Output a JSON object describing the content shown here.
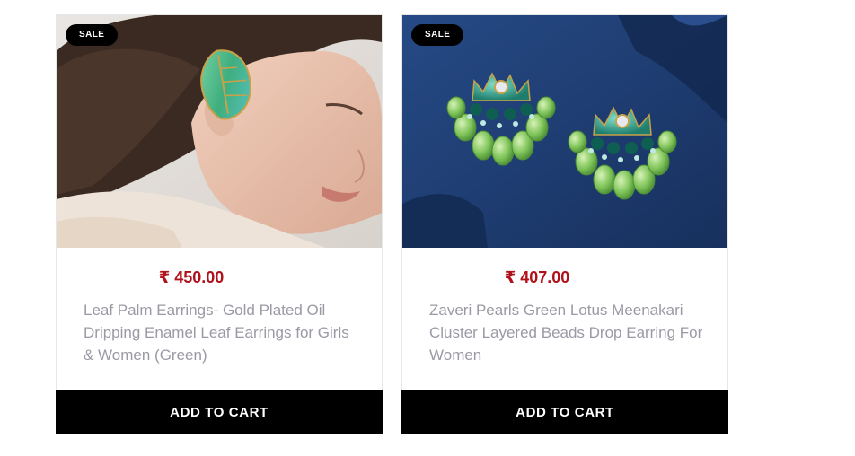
{
  "currency_symbol": "₹",
  "products": [
    {
      "badge": "SALE",
      "price": "₹ 450.00",
      "title": "Leaf Palm Earrings- Gold Plated Oil Dripping Enamel Leaf Earrings for Girls & Women (Green)",
      "cta": "ADD TO CART"
    },
    {
      "badge": "SALE",
      "price": "₹ 407.00",
      "title": "Zaveri Pearls Green Lotus Meenakari Cluster Layered Beads Drop Earring For Women",
      "cta": "ADD TO CART"
    }
  ],
  "colors": {
    "price": "#b0121b",
    "badge_bg": "#000000",
    "button_bg": "#000000",
    "title_text": "#9a9aa5",
    "backdrop_2": "#1d3a6e"
  }
}
